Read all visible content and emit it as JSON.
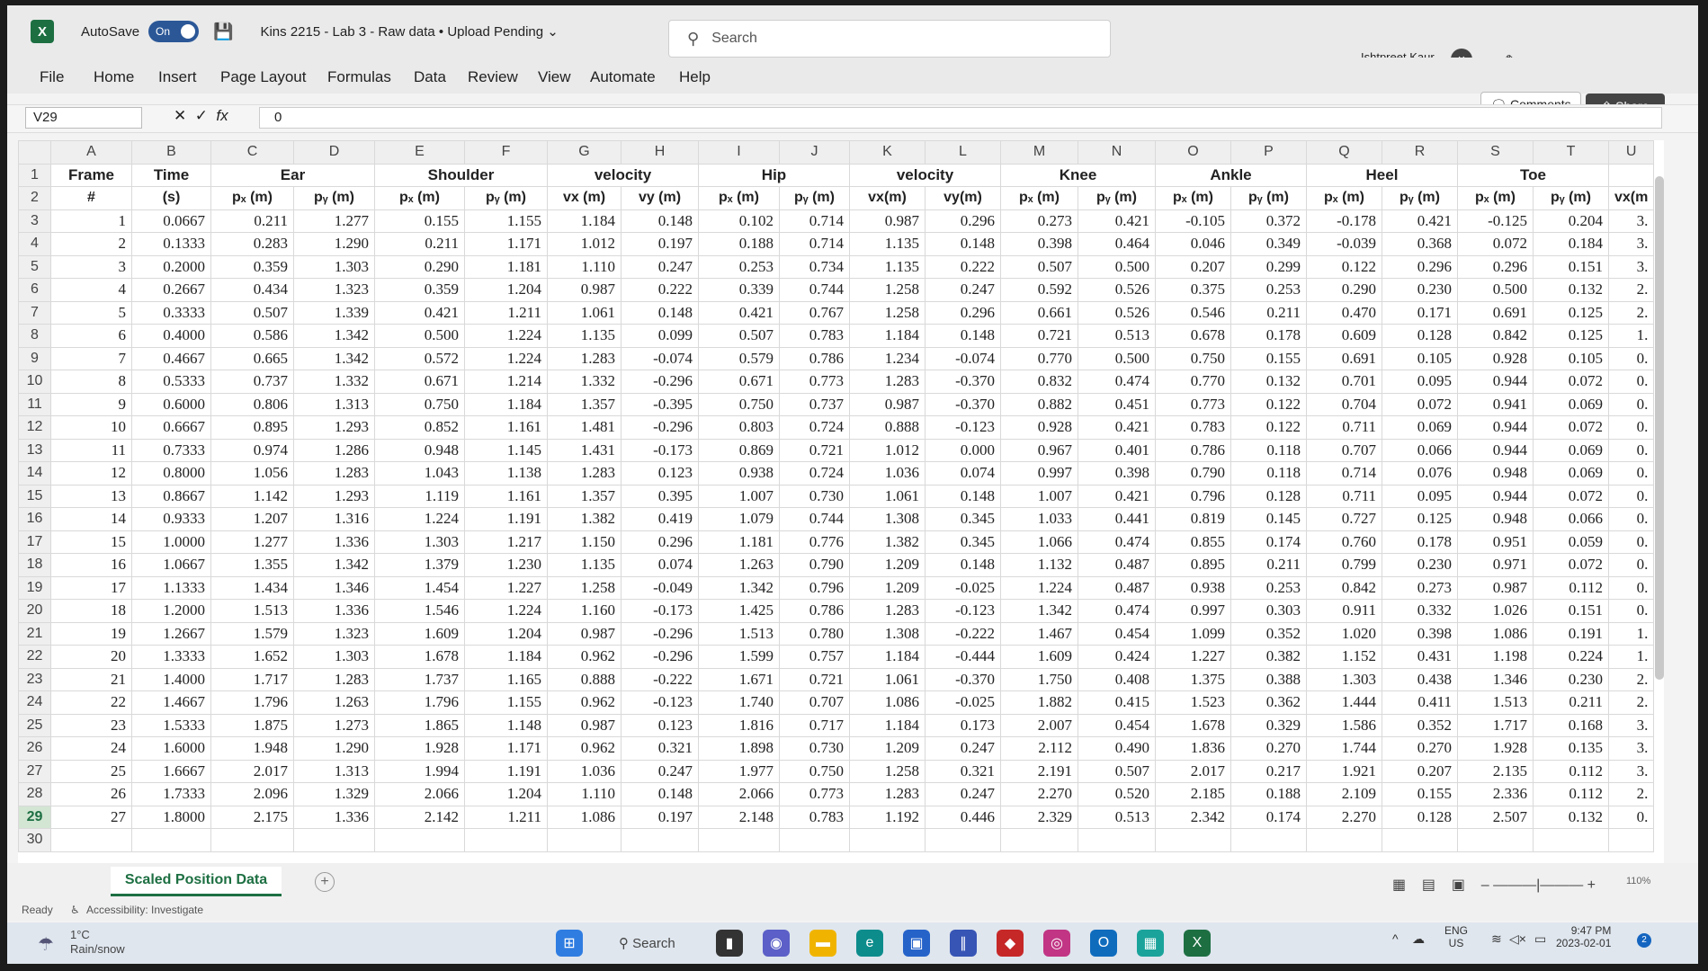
{
  "titlebar": {
    "app_letter": "X",
    "autosave_label": "AutoSave",
    "autosave_state": "On",
    "doc_title": "Kins 2215 - Lab 3 - Raw data • Upload Pending ⌄",
    "search_placeholder": "Search",
    "user_name": "Ishtpreet Kaur"
  },
  "menu": [
    "File",
    "Home",
    "Insert",
    "Page Layout",
    "Formulas",
    "Data",
    "Review",
    "View",
    "Automate",
    "Help"
  ],
  "ribbon_right": {
    "comments": "Comments",
    "share": "Share"
  },
  "formula_bar": {
    "cell_ref": "V29",
    "value": "0"
  },
  "columns": [
    "A",
    "B",
    "C",
    "D",
    "E",
    "F",
    "G",
    "H",
    "I",
    "J",
    "K",
    "L",
    "M",
    "N",
    "O",
    "P",
    "Q",
    "R",
    "S",
    "T",
    "U"
  ],
  "header1": {
    "frame": "Frame",
    "time": "Time",
    "ear": "Ear",
    "shoulder": "Shoulder",
    "velocity1": "velocity",
    "hip": "Hip",
    "velocity2": "velocity",
    "knee": "Knee",
    "ankle": "Ankle",
    "heel": "Heel",
    "toe": "Toe"
  },
  "header2": [
    "#",
    "(s)",
    "pₓ (m)",
    "pᵧ (m)",
    "pₓ (m)",
    "pᵧ (m)",
    "vx (m)",
    "vy (m)",
    "pₓ (m)",
    "pᵧ (m)",
    "vx(m)",
    "vy(m)",
    "pₓ (m)",
    "pᵧ (m)",
    "pₓ (m)",
    "pᵧ (m)",
    "pₓ (m)",
    "pᵧ (m)",
    "pₓ (m)",
    "pᵧ (m)",
    "vx(m"
  ],
  "rows": [
    [
      "1",
      "0.0667",
      "0.211",
      "1.277",
      "0.155",
      "1.155",
      "1.184",
      "0.148",
      "0.102",
      "0.714",
      "0.987",
      "0.296",
      "0.273",
      "0.421",
      "-0.105",
      "0.372",
      "-0.178",
      "0.421",
      "-0.125",
      "0.204",
      "3."
    ],
    [
      "2",
      "0.1333",
      "0.283",
      "1.290",
      "0.211",
      "1.171",
      "1.012",
      "0.197",
      "0.188",
      "0.714",
      "1.135",
      "0.148",
      "0.398",
      "0.464",
      "0.046",
      "0.349",
      "-0.039",
      "0.368",
      "0.072",
      "0.184",
      "3."
    ],
    [
      "3",
      "0.2000",
      "0.359",
      "1.303",
      "0.290",
      "1.181",
      "1.110",
      "0.247",
      "0.253",
      "0.734",
      "1.135",
      "0.222",
      "0.507",
      "0.500",
      "0.207",
      "0.299",
      "0.122",
      "0.296",
      "0.296",
      "0.151",
      "3."
    ],
    [
      "4",
      "0.2667",
      "0.434",
      "1.323",
      "0.359",
      "1.204",
      "0.987",
      "0.222",
      "0.339",
      "0.744",
      "1.258",
      "0.247",
      "0.592",
      "0.526",
      "0.375",
      "0.253",
      "0.290",
      "0.230",
      "0.500",
      "0.132",
      "2."
    ],
    [
      "5",
      "0.3333",
      "0.507",
      "1.339",
      "0.421",
      "1.211",
      "1.061",
      "0.148",
      "0.421",
      "0.767",
      "1.258",
      "0.296",
      "0.661",
      "0.526",
      "0.546",
      "0.211",
      "0.470",
      "0.171",
      "0.691",
      "0.125",
      "2."
    ],
    [
      "6",
      "0.4000",
      "0.586",
      "1.342",
      "0.500",
      "1.224",
      "1.135",
      "0.099",
      "0.507",
      "0.783",
      "1.184",
      "0.148",
      "0.721",
      "0.513",
      "0.678",
      "0.178",
      "0.609",
      "0.128",
      "0.842",
      "0.125",
      "1."
    ],
    [
      "7",
      "0.4667",
      "0.665",
      "1.342",
      "0.572",
      "1.224",
      "1.283",
      "-0.074",
      "0.579",
      "0.786",
      "1.234",
      "-0.074",
      "0.770",
      "0.500",
      "0.750",
      "0.155",
      "0.691",
      "0.105",
      "0.928",
      "0.105",
      "0."
    ],
    [
      "8",
      "0.5333",
      "0.737",
      "1.332",
      "0.671",
      "1.214",
      "1.332",
      "-0.296",
      "0.671",
      "0.773",
      "1.283",
      "-0.370",
      "0.832",
      "0.474",
      "0.770",
      "0.132",
      "0.701",
      "0.095",
      "0.944",
      "0.072",
      "0."
    ],
    [
      "9",
      "0.6000",
      "0.806",
      "1.313",
      "0.750",
      "1.184",
      "1.357",
      "-0.395",
      "0.750",
      "0.737",
      "0.987",
      "-0.370",
      "0.882",
      "0.451",
      "0.773",
      "0.122",
      "0.704",
      "0.072",
      "0.941",
      "0.069",
      "0."
    ],
    [
      "10",
      "0.6667",
      "0.895",
      "1.293",
      "0.852",
      "1.161",
      "1.481",
      "-0.296",
      "0.803",
      "0.724",
      "0.888",
      "-0.123",
      "0.928",
      "0.421",
      "0.783",
      "0.122",
      "0.711",
      "0.069",
      "0.944",
      "0.072",
      "0."
    ],
    [
      "11",
      "0.7333",
      "0.974",
      "1.286",
      "0.948",
      "1.145",
      "1.431",
      "-0.173",
      "0.869",
      "0.721",
      "1.012",
      "0.000",
      "0.967",
      "0.401",
      "0.786",
      "0.118",
      "0.707",
      "0.066",
      "0.944",
      "0.069",
      "0."
    ],
    [
      "12",
      "0.8000",
      "1.056",
      "1.283",
      "1.043",
      "1.138",
      "1.283",
      "0.123",
      "0.938",
      "0.724",
      "1.036",
      "0.074",
      "0.997",
      "0.398",
      "0.790",
      "0.118",
      "0.714",
      "0.076",
      "0.948",
      "0.069",
      "0."
    ],
    [
      "13",
      "0.8667",
      "1.142",
      "1.293",
      "1.119",
      "1.161",
      "1.357",
      "0.395",
      "1.007",
      "0.730",
      "1.061",
      "0.148",
      "1.007",
      "0.421",
      "0.796",
      "0.128",
      "0.711",
      "0.095",
      "0.944",
      "0.072",
      "0."
    ],
    [
      "14",
      "0.9333",
      "1.207",
      "1.316",
      "1.224",
      "1.191",
      "1.382",
      "0.419",
      "1.079",
      "0.744",
      "1.308",
      "0.345",
      "1.033",
      "0.441",
      "0.819",
      "0.145",
      "0.727",
      "0.125",
      "0.948",
      "0.066",
      "0."
    ],
    [
      "15",
      "1.0000",
      "1.277",
      "1.336",
      "1.303",
      "1.217",
      "1.150",
      "0.296",
      "1.181",
      "0.776",
      "1.382",
      "0.345",
      "1.066",
      "0.474",
      "0.855",
      "0.174",
      "0.760",
      "0.178",
      "0.951",
      "0.059",
      "0."
    ],
    [
      "16",
      "1.0667",
      "1.355",
      "1.342",
      "1.379",
      "1.230",
      "1.135",
      "0.074",
      "1.263",
      "0.790",
      "1.209",
      "0.148",
      "1.132",
      "0.487",
      "0.895",
      "0.211",
      "0.799",
      "0.230",
      "0.971",
      "0.072",
      "0."
    ],
    [
      "17",
      "1.1333",
      "1.434",
      "1.346",
      "1.454",
      "1.227",
      "1.258",
      "-0.049",
      "1.342",
      "0.796",
      "1.209",
      "-0.025",
      "1.224",
      "0.487",
      "0.938",
      "0.253",
      "0.842",
      "0.273",
      "0.987",
      "0.112",
      "0."
    ],
    [
      "18",
      "1.2000",
      "1.513",
      "1.336",
      "1.546",
      "1.224",
      "1.160",
      "-0.173",
      "1.425",
      "0.786",
      "1.283",
      "-0.123",
      "1.342",
      "0.474",
      "0.997",
      "0.303",
      "0.911",
      "0.332",
      "1.026",
      "0.151",
      "0."
    ],
    [
      "19",
      "1.2667",
      "1.579",
      "1.323",
      "1.609",
      "1.204",
      "0.987",
      "-0.296",
      "1.513",
      "0.780",
      "1.308",
      "-0.222",
      "1.467",
      "0.454",
      "1.099",
      "0.352",
      "1.020",
      "0.398",
      "1.086",
      "0.191",
      "1."
    ],
    [
      "20",
      "1.3333",
      "1.652",
      "1.303",
      "1.678",
      "1.184",
      "0.962",
      "-0.296",
      "1.599",
      "0.757",
      "1.184",
      "-0.444",
      "1.609",
      "0.424",
      "1.227",
      "0.382",
      "1.152",
      "0.431",
      "1.198",
      "0.224",
      "1."
    ],
    [
      "21",
      "1.4000",
      "1.717",
      "1.283",
      "1.737",
      "1.165",
      "0.888",
      "-0.222",
      "1.671",
      "0.721",
      "1.061",
      "-0.370",
      "1.750",
      "0.408",
      "1.375",
      "0.388",
      "1.303",
      "0.438",
      "1.346",
      "0.230",
      "2."
    ],
    [
      "22",
      "1.4667",
      "1.796",
      "1.263",
      "1.796",
      "1.155",
      "0.962",
      "-0.123",
      "1.740",
      "0.707",
      "1.086",
      "-0.025",
      "1.882",
      "0.415",
      "1.523",
      "0.362",
      "1.444",
      "0.411",
      "1.513",
      "0.211",
      "2."
    ],
    [
      "23",
      "1.5333",
      "1.875",
      "1.273",
      "1.865",
      "1.148",
      "0.987",
      "0.123",
      "1.816",
      "0.717",
      "1.184",
      "0.173",
      "2.007",
      "0.454",
      "1.678",
      "0.329",
      "1.586",
      "0.352",
      "1.717",
      "0.168",
      "3."
    ],
    [
      "24",
      "1.6000",
      "1.948",
      "1.290",
      "1.928",
      "1.171",
      "0.962",
      "0.321",
      "1.898",
      "0.730",
      "1.209",
      "0.247",
      "2.112",
      "0.490",
      "1.836",
      "0.270",
      "1.744",
      "0.270",
      "1.928",
      "0.135",
      "3."
    ],
    [
      "25",
      "1.6667",
      "2.017",
      "1.313",
      "1.994",
      "1.191",
      "1.036",
      "0.247",
      "1.977",
      "0.750",
      "1.258",
      "0.321",
      "2.191",
      "0.507",
      "2.017",
      "0.217",
      "1.921",
      "0.207",
      "2.135",
      "0.112",
      "3."
    ],
    [
      "26",
      "1.7333",
      "2.096",
      "1.329",
      "2.066",
      "1.204",
      "1.110",
      "0.148",
      "2.066",
      "0.773",
      "1.283",
      "0.247",
      "2.270",
      "0.520",
      "2.185",
      "0.188",
      "2.109",
      "0.155",
      "2.336",
      "0.112",
      "2."
    ],
    [
      "27",
      "1.8000",
      "2.175",
      "1.336",
      "2.142",
      "1.211",
      "1.086",
      "0.197",
      "2.148",
      "0.783",
      "1.192",
      "0.446",
      "2.329",
      "0.513",
      "2.342",
      "0.174",
      "2.270",
      "0.128",
      "2.507",
      "0.132",
      "0."
    ]
  ],
  "sheet_tab": "Scaled Position Data",
  "status": {
    "ready": "Ready",
    "accessibility": "Accessibility: Investigate",
    "zoom": "110%"
  },
  "taskbar": {
    "weather_temp": "1°C",
    "weather_desc": "Rain/snow",
    "search": "Search",
    "lang": "ENG",
    "region": "US",
    "time": "9:47 PM",
    "date": "2023-02-01"
  },
  "colors": {
    "excel_green": "#1d6f42",
    "share_bg": "#444444"
  }
}
